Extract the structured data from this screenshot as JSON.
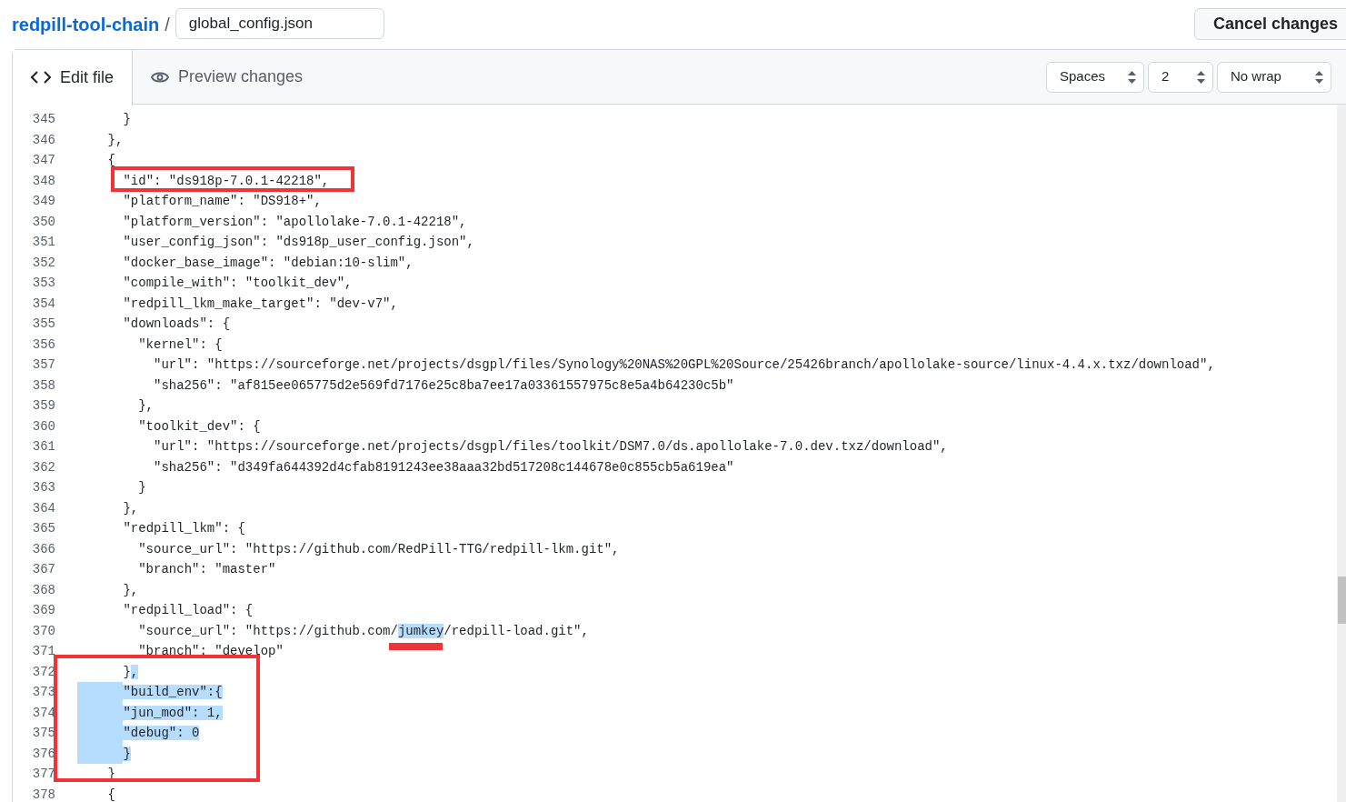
{
  "breadcrumb": {
    "repo": "redpill-tool-chain",
    "separator": "/",
    "filename": "global_config.json"
  },
  "cancel_button": "Cancel changes",
  "tabs": [
    {
      "label": "Edit file",
      "selected": true
    },
    {
      "label": "Preview changes",
      "selected": false
    }
  ],
  "options": [
    "Spaces",
    "2",
    "No wrap"
  ],
  "lines": [
    {
      "num": "345",
      "segments": [
        {
          "text": "      }",
          "selected": false
        }
      ]
    },
    {
      "num": "346",
      "segments": [
        {
          "text": "    },",
          "selected": false
        }
      ]
    },
    {
      "num": "347",
      "segments": [
        {
          "text": "    {",
          "selected": false
        }
      ]
    },
    {
      "num": "348",
      "segments": [
        {
          "text": "      \"id\": \"ds918p-7.0.1-42218\",",
          "selected": false
        }
      ]
    },
    {
      "num": "349",
      "segments": [
        {
          "text": "      \"platform_name\": \"DS918+\",",
          "selected": false
        }
      ]
    },
    {
      "num": "350",
      "segments": [
        {
          "text": "      \"platform_version\": \"apollolake-7.0.1-42218\",",
          "selected": false
        }
      ]
    },
    {
      "num": "351",
      "segments": [
        {
          "text": "      \"user_config_json\": \"ds918p_user_config.json\",",
          "selected": false
        }
      ]
    },
    {
      "num": "352",
      "segments": [
        {
          "text": "      \"docker_base_image\": \"debian:10-slim\",",
          "selected": false
        }
      ]
    },
    {
      "num": "353",
      "segments": [
        {
          "text": "      \"compile_with\": \"toolkit_dev\",",
          "selected": false
        }
      ]
    },
    {
      "num": "354",
      "segments": [
        {
          "text": "      \"redpill_lkm_make_target\": \"dev-v7\",",
          "selected": false
        }
      ]
    },
    {
      "num": "355",
      "segments": [
        {
          "text": "      \"downloads\": {",
          "selected": false
        }
      ]
    },
    {
      "num": "356",
      "segments": [
        {
          "text": "        \"kernel\": {",
          "selected": false
        }
      ]
    },
    {
      "num": "357",
      "segments": [
        {
          "text": "          \"url\": \"https://sourceforge.net/projects/dsgpl/files/Synology%20NAS%20GPL%20Source/25426branch/apollolake-source/linux-4.4.x.txz/download\",",
          "selected": false
        }
      ]
    },
    {
      "num": "358",
      "segments": [
        {
          "text": "          \"sha256\": \"af815ee065775d2e569fd7176e25c8ba7ee17a03361557975c8e5a4b64230c5b\"",
          "selected": false
        }
      ]
    },
    {
      "num": "359",
      "segments": [
        {
          "text": "        },",
          "selected": false
        }
      ]
    },
    {
      "num": "360",
      "segments": [
        {
          "text": "        \"toolkit_dev\": {",
          "selected": false
        }
      ]
    },
    {
      "num": "361",
      "segments": [
        {
          "text": "          \"url\": \"https://sourceforge.net/projects/dsgpl/files/toolkit/DSM7.0/ds.apollolake-7.0.dev.txz/download\",",
          "selected": false
        }
      ]
    },
    {
      "num": "362",
      "segments": [
        {
          "text": "          \"sha256\": \"d349fa644392d4cfab8191243ee38aaa32bd517208c144678e0c855cb5a619ea\"",
          "selected": false
        }
      ]
    },
    {
      "num": "363",
      "segments": [
        {
          "text": "        }",
          "selected": false
        }
      ]
    },
    {
      "num": "364",
      "segments": [
        {
          "text": "      },",
          "selected": false
        }
      ]
    },
    {
      "num": "365",
      "segments": [
        {
          "text": "      \"redpill_lkm\": {",
          "selected": false
        }
      ]
    },
    {
      "num": "366",
      "segments": [
        {
          "text": "        \"source_url\": \"https://github.com/RedPill-TTG/redpill-lkm.git\",",
          "selected": false
        }
      ]
    },
    {
      "num": "367",
      "segments": [
        {
          "text": "        \"branch\": \"master\"",
          "selected": false
        }
      ]
    },
    {
      "num": "368",
      "segments": [
        {
          "text": "      },",
          "selected": false
        }
      ]
    },
    {
      "num": "369",
      "segments": [
        {
          "text": "      \"redpill_load\": {",
          "selected": false
        }
      ]
    },
    {
      "num": "370",
      "segments": [
        {
          "text": "        \"source_url\": \"https://github.com/",
          "selected": false
        },
        {
          "text": "jumkey",
          "selected": true
        },
        {
          "text": "/redpill-load.git\",",
          "selected": false
        }
      ]
    },
    {
      "num": "371",
      "segments": [
        {
          "text": "        \"branch\": \"develop\"",
          "selected": false
        }
      ]
    },
    {
      "num": "372",
      "segments": [
        {
          "text": "      }",
          "selected": false
        },
        {
          "text": ",",
          "selected": true
        }
      ]
    },
    {
      "num": "373",
      "segments": [
        {
          "text": "      \"build_env\":{",
          "selected": true
        }
      ]
    },
    {
      "num": "374",
      "segments": [
        {
          "text": "      \"jun_mod\": 1,",
          "selected": true
        }
      ]
    },
    {
      "num": "375",
      "segments": [
        {
          "text": "      \"debug\": 0",
          "selected": true
        }
      ]
    },
    {
      "num": "376",
      "segments": [
        {
          "text": "      }",
          "selected": true
        }
      ]
    },
    {
      "num": "377",
      "segments": [
        {
          "text": "    }",
          "selected": false
        }
      ]
    },
    {
      "num": "378",
      "segments": [
        {
          "text": "    {",
          "selected": false
        }
      ]
    }
  ]
}
